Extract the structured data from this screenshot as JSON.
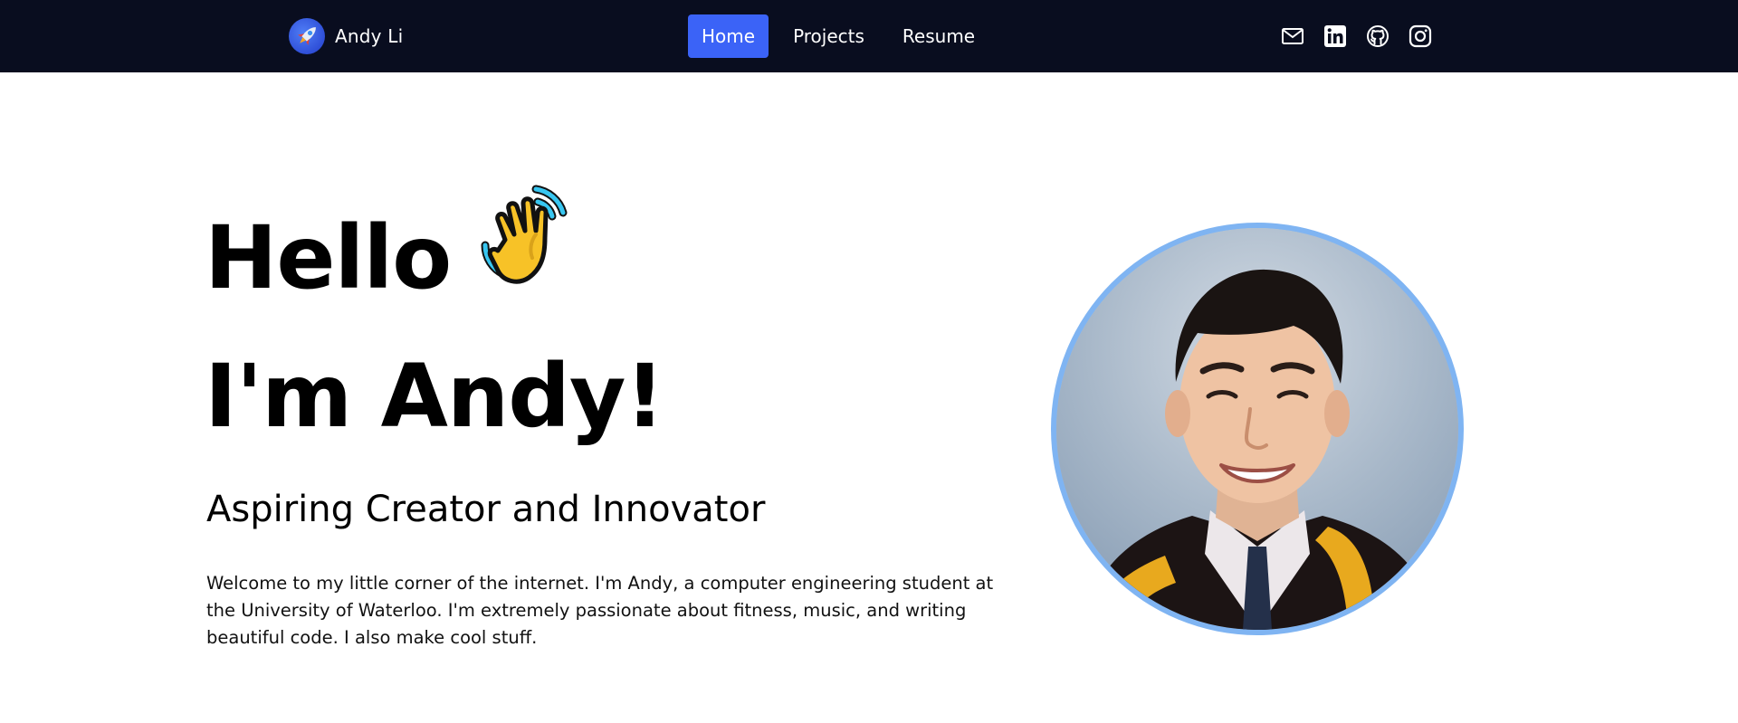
{
  "brand": {
    "name": "Andy Li",
    "logo_icon": "rocket-icon"
  },
  "nav": {
    "links": [
      {
        "label": "Home",
        "active": true
      },
      {
        "label": "Projects",
        "active": false
      },
      {
        "label": "Resume",
        "active": false
      }
    ],
    "active_color": "#3b63f7"
  },
  "social": {
    "icons": [
      "mail-icon",
      "linkedin-icon",
      "github-icon",
      "instagram-icon"
    ]
  },
  "hero": {
    "line1": "Hello",
    "line2": "I'm Andy!",
    "wave_icon": "waving-hand-icon",
    "subtitle": "Aspiring Creator and Innovator",
    "intro": "Welcome to my little corner of the internet. I'm Andy, a computer engineering student at the University of Waterloo. I'm extremely passionate about fitness, music, and writing beautiful code. I also make cool stuff."
  },
  "portrait": {
    "ring_color": "#7fb4f2"
  },
  "colors": {
    "navbar_bg": "#090d1f",
    "text": "#000000"
  }
}
